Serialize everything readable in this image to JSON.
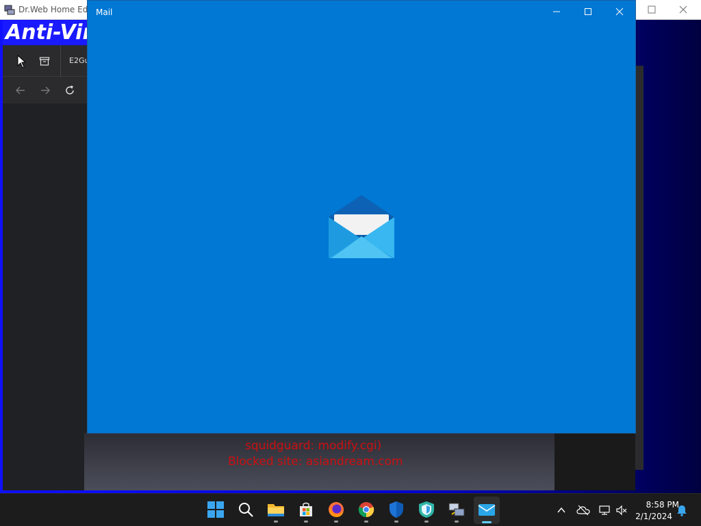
{
  "background_window": {
    "title": "Dr.Web Home Editi",
    "banner": "Anti-Viru",
    "browser_tab": "E2Gu",
    "blocked_line1": "squidguard: modify.cgi)",
    "blocked_line2": "Blocked site: asiandream.com"
  },
  "mail_window": {
    "title": "Mail",
    "splash_icon": "envelope-icon",
    "background_color": "#0078d4"
  },
  "taskbar": {
    "apps": [
      {
        "name": "start",
        "icon": "windows-logo-icon"
      },
      {
        "name": "search",
        "icon": "search-icon"
      },
      {
        "name": "file-explorer",
        "icon": "folder-icon"
      },
      {
        "name": "microsoft-store",
        "icon": "store-icon"
      },
      {
        "name": "firefox",
        "icon": "firefox-icon"
      },
      {
        "name": "chrome",
        "icon": "chrome-icon"
      },
      {
        "name": "windows-security",
        "icon": "shield-icon"
      },
      {
        "name": "defender",
        "icon": "defender-icon"
      },
      {
        "name": "remote-desktop",
        "icon": "network-computer-icon"
      },
      {
        "name": "mail",
        "icon": "mail-icon",
        "active": true
      }
    ],
    "tray": {
      "time": "8:58 PM",
      "date": "2/1/2024"
    }
  }
}
